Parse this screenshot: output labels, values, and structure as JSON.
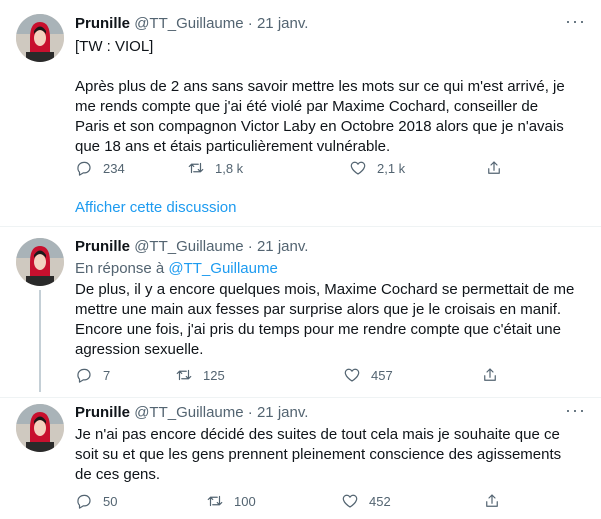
{
  "tweets": [
    {
      "name": "Prunille",
      "handle": "@TT_Guillaume",
      "separator": "·",
      "date": "21 janv.",
      "text": "[TW : VIOL]\n\nAprès plus de 2 ans sans savoir mettre les mots sur ce qui m'est arrivé, je me rends compte que j'ai été violé par Maxime Cochard, conseiller de Paris et son compagnon Victor Laby en Octobre 2018 alors que je n'avais que 18 ans et étais particulièrement vulnérable.",
      "replies": "234",
      "retweets": "1,8 k",
      "likes": "2,1 k"
    },
    {
      "name": "Prunille",
      "handle": "@TT_Guillaume",
      "separator": "·",
      "date": "21 janv.",
      "replying_prefix": "En réponse à",
      "replying_to": "@TT_Guillaume",
      "text": "De plus, il y a encore quelques mois, Maxime Cochard se permettait de me mettre une main aux fesses par surprise alors que je le croisais en manif. Encore une fois, j'ai pris du temps pour me rendre compte que c'était une agression sexuelle.",
      "replies": "7",
      "retweets": "125",
      "likes": "457"
    },
    {
      "name": "Prunille",
      "handle": "@TT_Guillaume",
      "separator": "·",
      "date": "21 janv.",
      "text": "Je n'ai pas encore décidé des suites de tout cela mais je souhaite que ce soit su et que les gens prennent pleinement conscience des agissements de ces gens.",
      "replies": "50",
      "retweets": "100",
      "likes": "452"
    }
  ],
  "show_thread_label": "Afficher cette discussion",
  "icons": {
    "more": "more-horizontal-icon",
    "reply": "reply-bubble-icon",
    "retweet": "retweet-arrows-icon",
    "like": "heart-icon",
    "share": "share-upload-icon"
  },
  "colors": {
    "text": "#0f1419",
    "muted": "#536471",
    "link": "#1d9bf0",
    "divider": "#eff3f4",
    "thread_line": "#c4cfd6"
  }
}
